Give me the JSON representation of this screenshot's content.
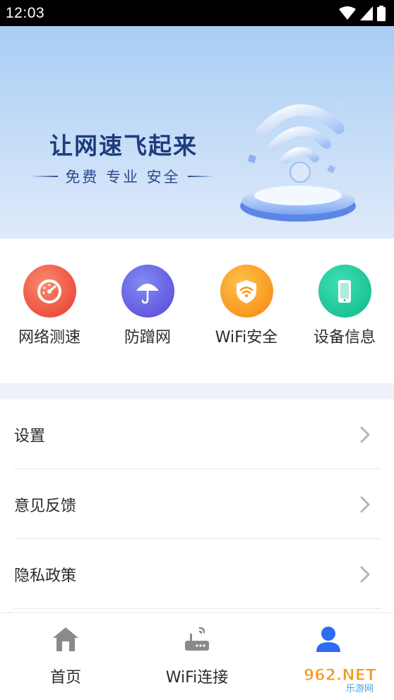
{
  "status_bar": {
    "time": "12:03",
    "icons": [
      "wifi-signal-icon",
      "cell-signal-icon",
      "battery-icon"
    ]
  },
  "banner": {
    "title": "让网速飞起来",
    "subtitle": "免费 专业 安全"
  },
  "features": [
    {
      "label": "网络测速",
      "icon": "speedometer-icon",
      "color": "#ef4c3b"
    },
    {
      "label": "防蹭网",
      "icon": "umbrella-icon",
      "color": "#6a5ae0"
    },
    {
      "label": "WiFi安全",
      "icon": "wifi-shield-icon",
      "color": "#f79b1b"
    },
    {
      "label": "设备信息",
      "icon": "phone-icon",
      "color": "#1ac69a"
    }
  ],
  "menu": [
    {
      "label": "设置"
    },
    {
      "label": "意见反馈"
    },
    {
      "label": "隐私政策"
    }
  ],
  "bottom_nav": [
    {
      "label": "首页",
      "icon": "home-icon",
      "active": false
    },
    {
      "label": "WiFi连接",
      "icon": "router-icon",
      "active": false
    },
    {
      "label": "",
      "icon": "user-icon",
      "active": true
    }
  ],
  "colors": {
    "accent": "#2f6bf0",
    "icon_gray": "#8a8a8a"
  },
  "watermark": {
    "text_main": "962.NET",
    "text_sub": "乐游网"
  }
}
